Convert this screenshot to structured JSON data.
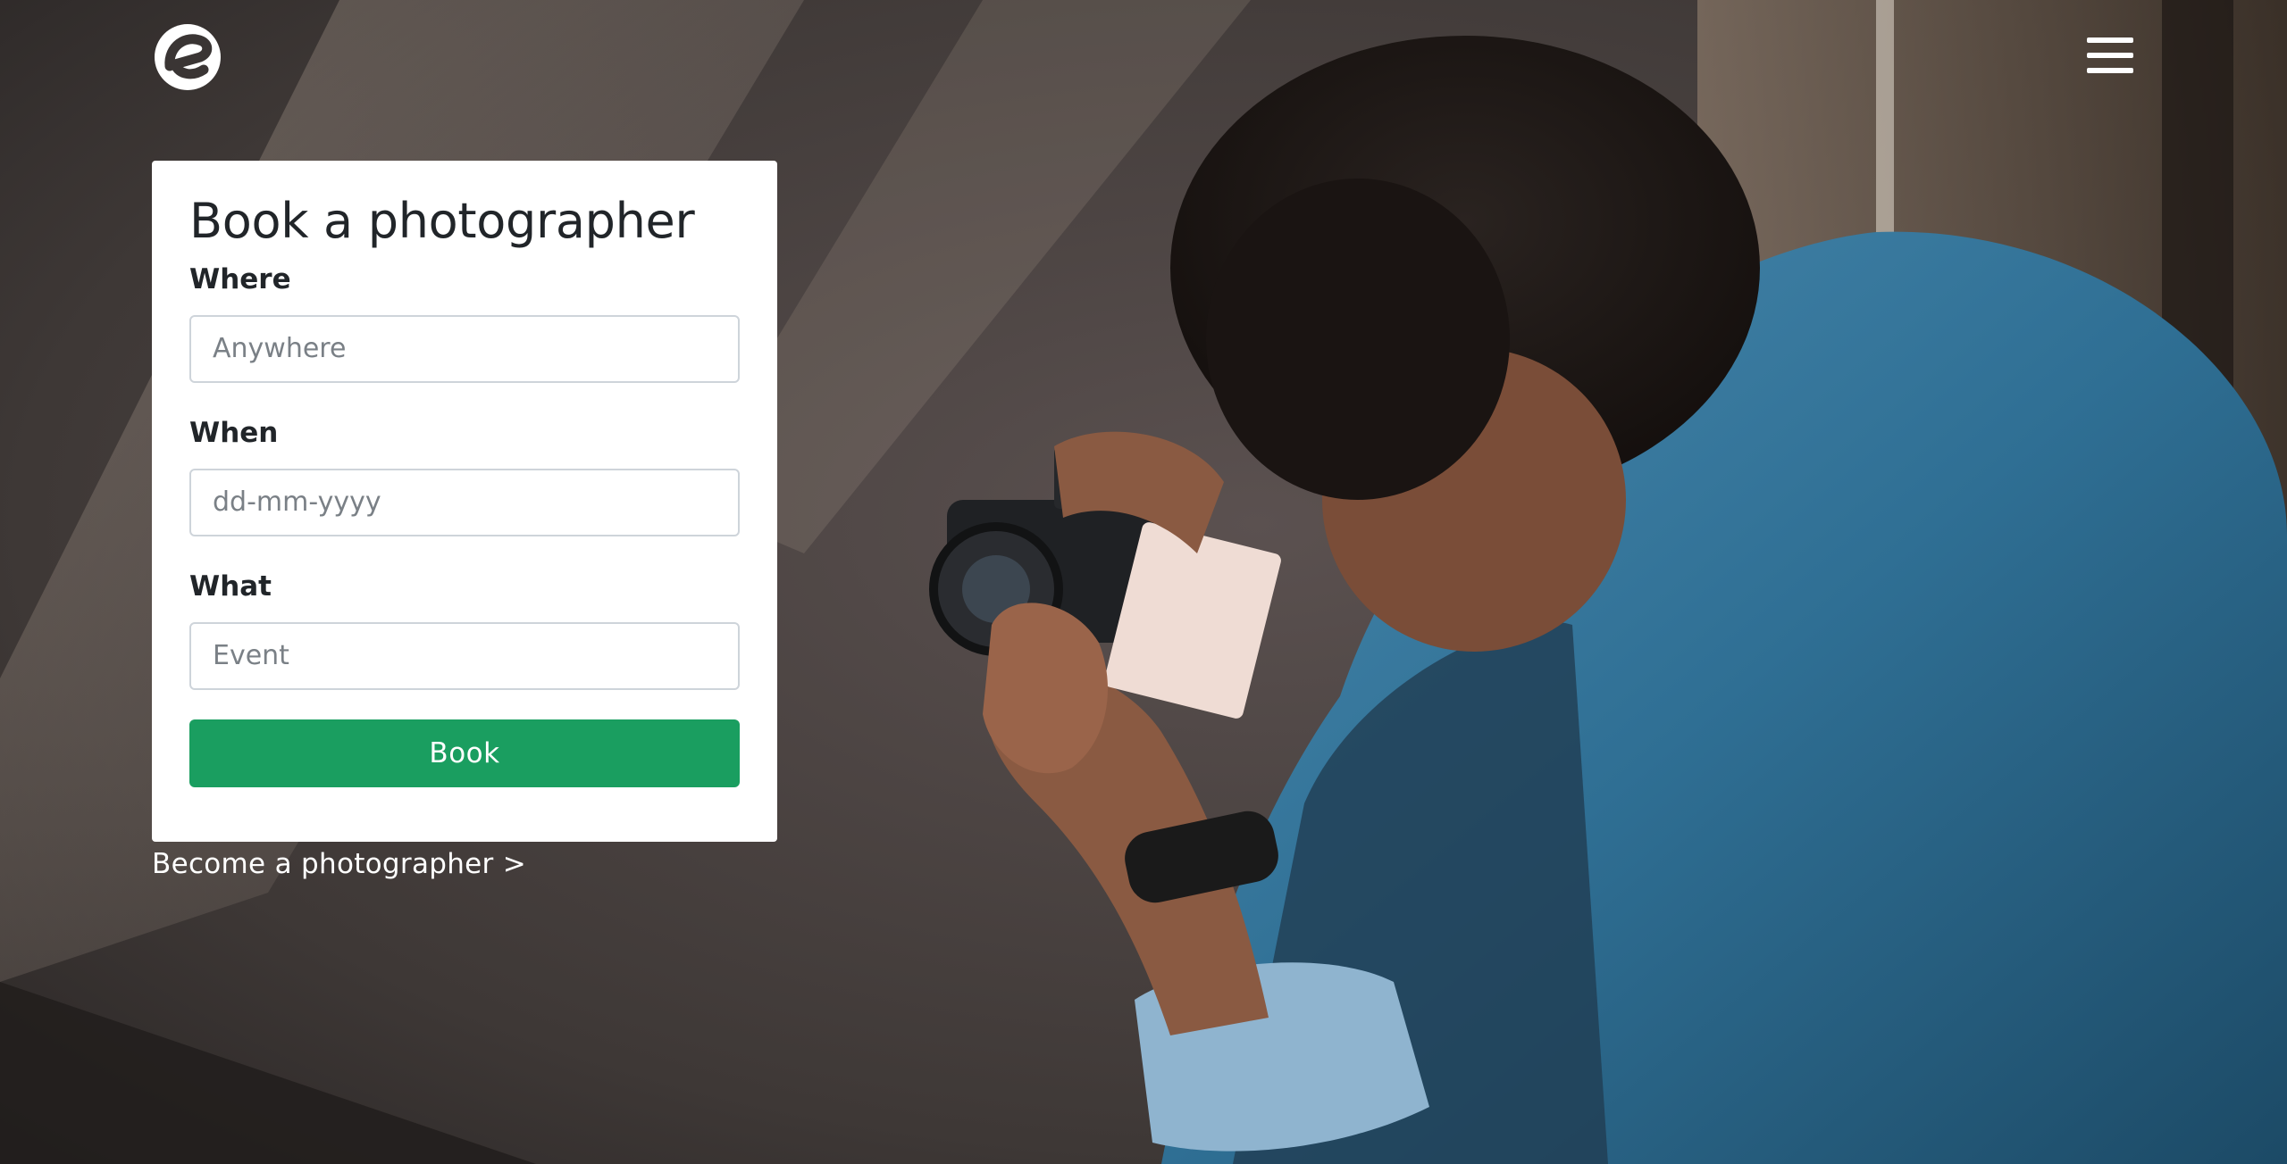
{
  "header": {
    "logo_icon": "brand-e-logo-icon",
    "menu_icon": "hamburger-menu-icon"
  },
  "booking": {
    "title": "Book a photographer",
    "where_label": "Where",
    "where_placeholder": "Anywhere",
    "when_label": "When",
    "when_placeholder": "dd-mm-yyyy",
    "what_label": "What",
    "what_placeholder": "Event",
    "book_button": "Book"
  },
  "become_link": "Become a photographer >",
  "colors": {
    "primary_button": "#1a9e60",
    "card_background": "#ffffff",
    "text": "#212529"
  }
}
